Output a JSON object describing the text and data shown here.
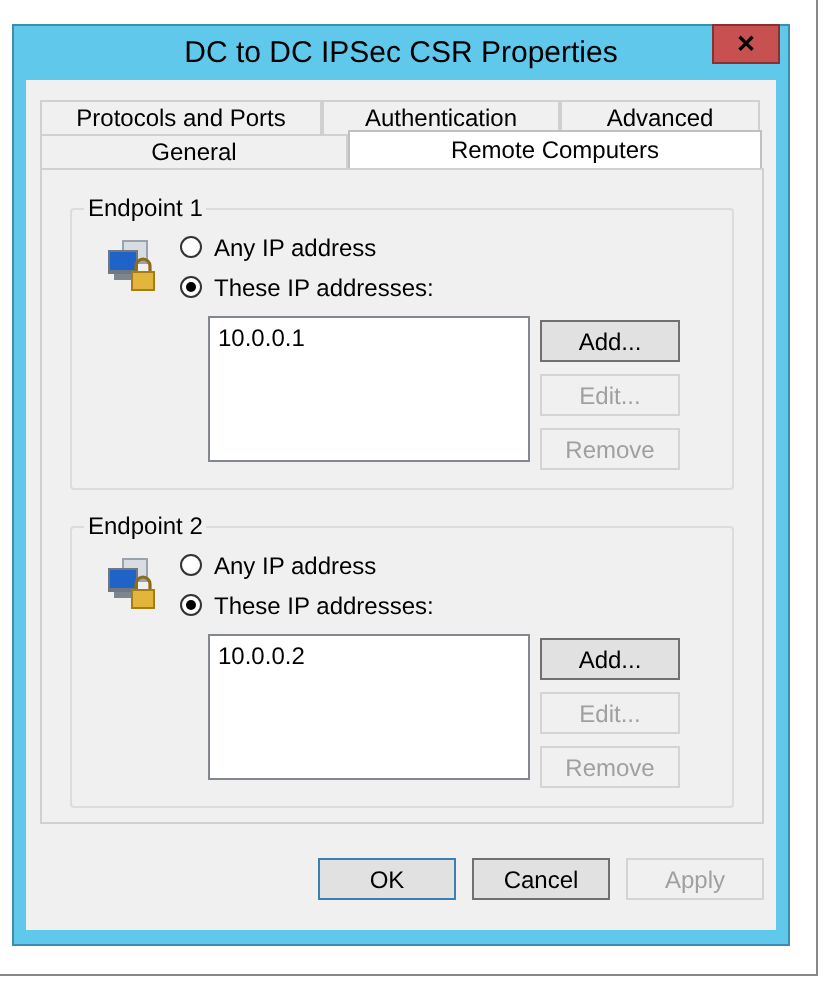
{
  "window": {
    "title": "DC to DC IPSec CSR Properties",
    "close": "✕"
  },
  "tab_rows": [
    [
      {
        "label": "Protocols and Ports",
        "selected": false
      },
      {
        "label": "Authentication",
        "selected": false
      },
      {
        "label": "Advanced",
        "selected": false
      }
    ],
    [
      {
        "label": "General",
        "selected": false
      },
      {
        "label": "Remote Computers",
        "selected": true
      }
    ]
  ],
  "endpoints": [
    {
      "title": "Endpoint 1",
      "options": [
        {
          "label": "Any IP address",
          "selected": false
        },
        {
          "label": "These IP addresses:",
          "selected": true
        }
      ],
      "addresses": [
        "10.0.0.1"
      ],
      "buttons": [
        {
          "label": "Add...",
          "disabled": false
        },
        {
          "label": "Edit...",
          "disabled": true
        },
        {
          "label": "Remove",
          "disabled": true
        }
      ]
    },
    {
      "title": "Endpoint 2",
      "options": [
        {
          "label": "Any IP address",
          "selected": false
        },
        {
          "label": "These IP addresses:",
          "selected": true
        }
      ],
      "addresses": [
        "10.0.0.2"
      ],
      "buttons": [
        {
          "label": "Add...",
          "disabled": false
        },
        {
          "label": "Edit...",
          "disabled": true
        },
        {
          "label": "Remove",
          "disabled": true
        }
      ]
    }
  ],
  "buttons": [
    {
      "label": "OK",
      "disabled": false,
      "default": true
    },
    {
      "label": "Cancel",
      "disabled": false,
      "default": false
    },
    {
      "label": "Apply",
      "disabled": true,
      "default": false
    }
  ]
}
